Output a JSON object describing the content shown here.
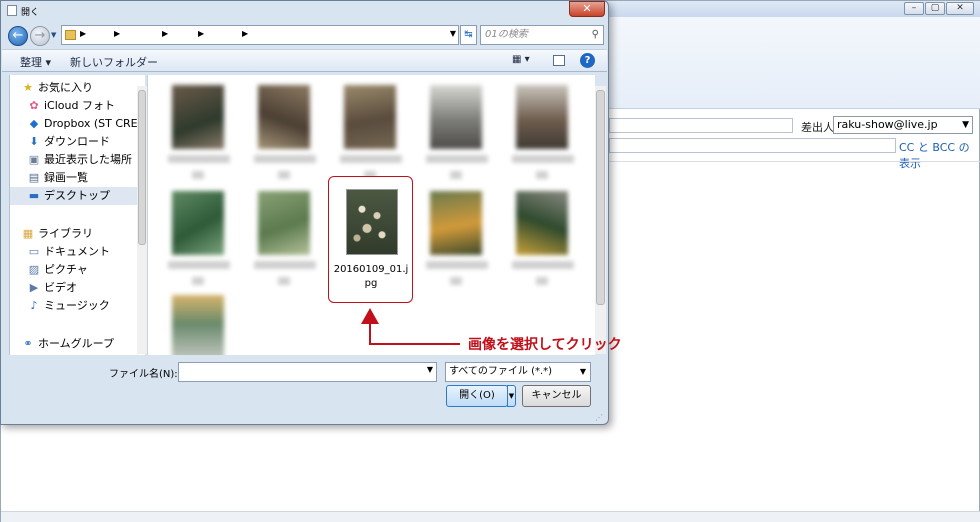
{
  "dialog": {
    "title": "開く",
    "close_label": "✕",
    "search_placeholder": "01の検索",
    "toolbar": {
      "organize": "整理 ▾",
      "new_folder": "新しいフォルダー",
      "view": "▦ ▾",
      "help": "?"
    },
    "nav": {
      "favorites": "お気に入り",
      "icloud": "iCloud フォト",
      "dropbox": "Dropbox (ST CREATI",
      "downloads": "ダウンロード",
      "recent": "最近表示した場所",
      "recordings": "録画一覧",
      "desktop": "デスクトップ",
      "libraries": "ライブラリ",
      "documents": "ドキュメント",
      "pictures": "ピクチャ",
      "videos": "ビデオ",
      "music": "ミュージック",
      "homegroup": "ホームグループ"
    },
    "selected_file": "20160109_01.jpg",
    "filename_label": "ファイル名(N):",
    "filetype": "すべてのファイル (*.*)",
    "open_button": "開く(O)",
    "cancel_button": "キャンセル"
  },
  "mail": {
    "from_label": "差出人",
    "from_value": "raku-show@live.jp",
    "cc_link": "CC と BCC の表示"
  },
  "annotation": {
    "text": "画像を選択してクリック",
    "color": "#c0101a"
  }
}
